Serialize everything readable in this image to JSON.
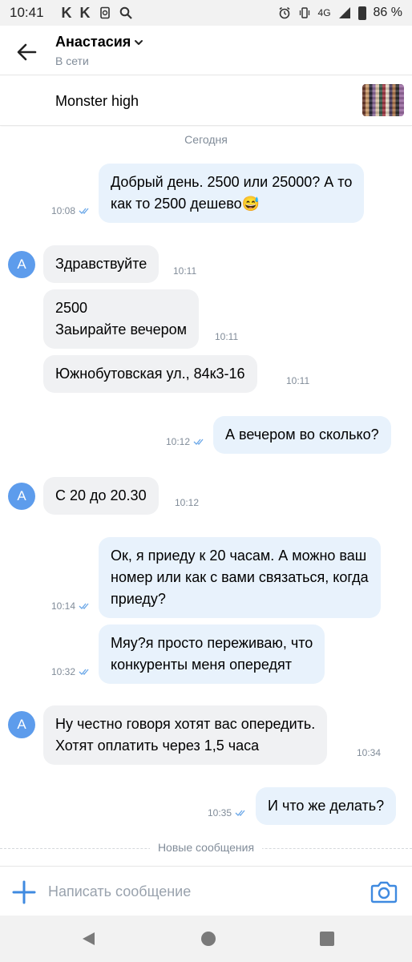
{
  "status_bar": {
    "time": "10:41",
    "left_icons": [
      "k-icon",
      "k-icon",
      "copy-icon",
      "search-icon"
    ],
    "network": "4G",
    "battery": "86 %"
  },
  "header": {
    "contact_name": "Анастасия",
    "status": "В сети"
  },
  "product": {
    "title": "Monster high"
  },
  "chat": {
    "date_label": "Сегодня",
    "avatar_letter": "А",
    "messages": [
      {
        "dir": "out",
        "lines": [
          "Добрый день. 2500 или 25000? А то",
          "как то 2500 дешево😅"
        ],
        "time": "10:08",
        "read": true
      },
      {
        "dir": "in",
        "lines": [
          "Здравствуйте"
        ],
        "time": "10:11"
      },
      {
        "dir": "in",
        "lines": [
          "2500",
          "Заьирайте вечером"
        ],
        "time": "10:11"
      },
      {
        "dir": "in",
        "lines": [
          "Южнобутовская ул., 84к3-16"
        ],
        "time": "10:11"
      },
      {
        "dir": "out",
        "lines": [
          "А вечером во сколько?"
        ],
        "time": "10:12",
        "read": true
      },
      {
        "dir": "in",
        "lines": [
          "С 20 до 20.30"
        ],
        "time": "10:12"
      },
      {
        "dir": "out",
        "lines": [
          "Ок, я приеду к 20 часам. А можно ваш",
          "номер или как с вами связаться, когда",
          "приеду?"
        ],
        "time": "10:14",
        "read": true
      },
      {
        "dir": "out",
        "lines": [
          "Мяу?я просто переживаю, что",
          "конкуренты меня опередят"
        ],
        "time": "10:32",
        "read": true
      },
      {
        "dir": "in",
        "lines": [
          "Ну честно говоря хотят вас опередить.",
          "Хотят оплатить через 1,5 часа"
        ],
        "time": "10:34"
      },
      {
        "dir": "out",
        "lines": [
          "И что же делать?"
        ],
        "time": "10:35",
        "read": true
      }
    ],
    "new_messages_label": "Новые сообщения"
  },
  "composer": {
    "placeholder": "Написать сообщение"
  },
  "colors": {
    "accent": "#3f8ae0",
    "outgoing_bubble": "#e8f2fc",
    "incoming_bubble": "#f0f1f3",
    "avatar": "#5d9cec",
    "secondary_text": "#818c99"
  }
}
